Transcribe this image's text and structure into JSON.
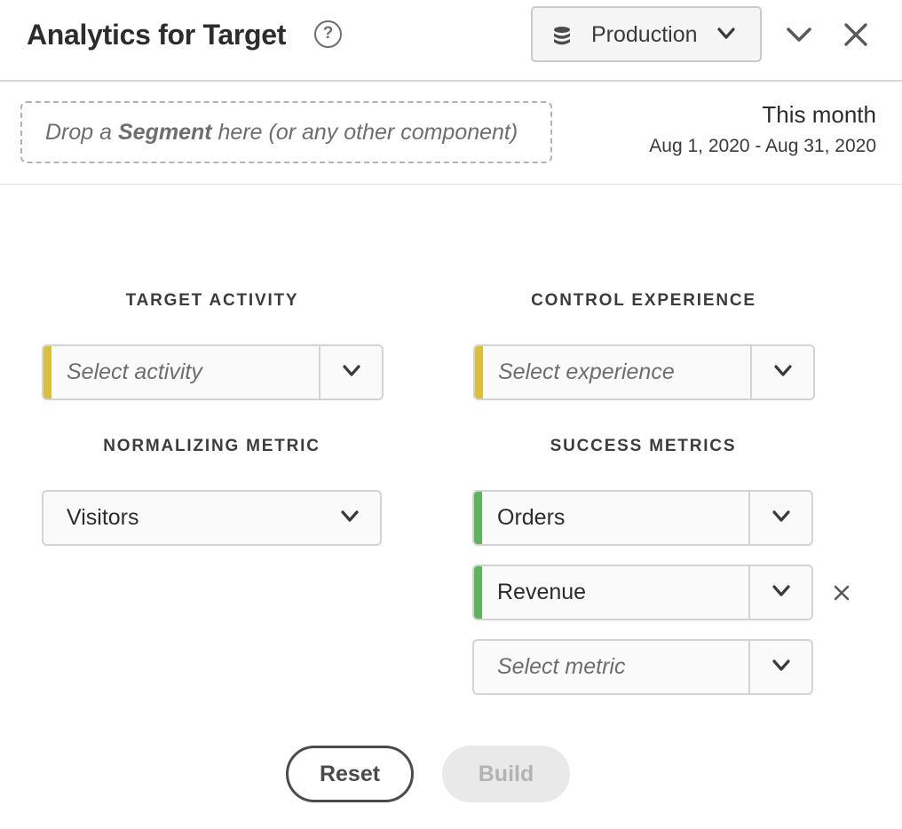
{
  "header": {
    "title": "Analytics for Target",
    "help_glyph": "?",
    "help_icon": "help-circle-icon",
    "environment_select": {
      "value": "Production",
      "icon": "database-icon"
    },
    "collapse_icon": "chevron-down-icon",
    "close_icon": "close-icon"
  },
  "segment": {
    "drop_prefix": "Drop a ",
    "drop_strong": "Segment",
    "drop_suffix": " here (or any other component)"
  },
  "date_range": {
    "title": "This month",
    "range": "Aug 1, 2020 - Aug 31, 2020"
  },
  "target_activity": {
    "label": "TARGET ACTIVITY",
    "placeholder": "Select activity"
  },
  "control_experience": {
    "label": "CONTROL EXPERIENCE",
    "placeholder": "Select experience"
  },
  "normalizing_metric": {
    "label": "NORMALIZING METRIC",
    "value": "Visitors"
  },
  "success_metrics": {
    "label": "SUCCESS METRICS",
    "items": [
      {
        "value": "Orders",
        "removable": false
      },
      {
        "value": "Revenue",
        "removable": true
      }
    ],
    "placeholder": "Select metric"
  },
  "actions": {
    "reset_label": "Reset",
    "build_label": "Build",
    "build_enabled": false
  },
  "colors": {
    "required_accent": "#dbbe3a",
    "filled_accent": "#5db45f",
    "border": "#d3d3d3",
    "disabled_bg": "#e9e9e9"
  }
}
